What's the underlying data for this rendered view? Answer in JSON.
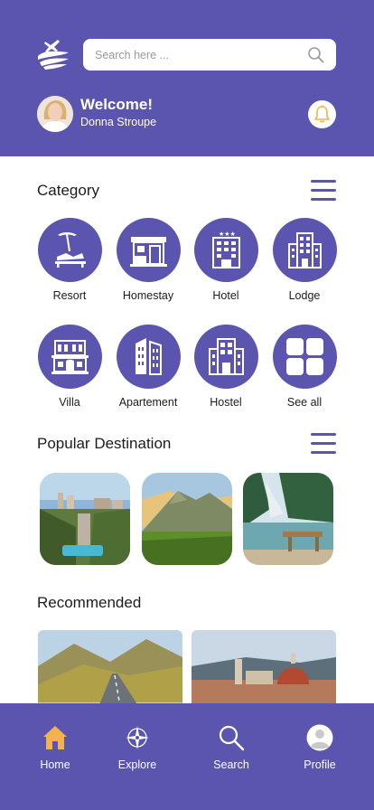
{
  "header": {
    "search_placeholder": "Search here ...",
    "welcome": "Welcome!",
    "user_name": "Donna Stroupe"
  },
  "categories": {
    "title": "Category",
    "items": [
      {
        "label": "Resort",
        "icon": "resort-icon"
      },
      {
        "label": "Homestay",
        "icon": "homestay-icon"
      },
      {
        "label": "Hotel",
        "icon": "hotel-icon"
      },
      {
        "label": "Lodge",
        "icon": "lodge-icon"
      },
      {
        "label": "Villa",
        "icon": "villa-icon"
      },
      {
        "label": "Apartement",
        "icon": "apartment-icon"
      },
      {
        "label": "Hostel",
        "icon": "hostel-icon"
      },
      {
        "label": "See all",
        "icon": "grid-icon"
      }
    ]
  },
  "popular": {
    "title": "Popular Destination"
  },
  "recommended": {
    "title": "Recommended"
  },
  "nav": {
    "items": [
      {
        "label": "Home",
        "icon": "home-icon",
        "active": true
      },
      {
        "label": "Explore",
        "icon": "compass-icon"
      },
      {
        "label": "Search",
        "icon": "search-icon"
      },
      {
        "label": "Profile",
        "icon": "profile-icon"
      }
    ]
  },
  "colors": {
    "primary": "#5b55b0",
    "active_nav": "#f4b24c",
    "notification_bell": "#f4b24c"
  }
}
